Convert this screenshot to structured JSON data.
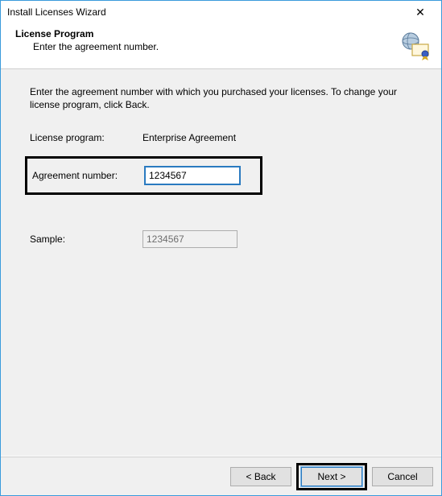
{
  "window": {
    "title": "Install Licenses Wizard",
    "close_glyph": "✕"
  },
  "header": {
    "heading": "License Program",
    "sub": "Enter the agreement number."
  },
  "main": {
    "intro": "Enter the agreement number with which you purchased your licenses. To change your license program, click Back.",
    "license_program_label": "License program:",
    "license_program_value": "Enterprise Agreement",
    "agreement_label": "Agreement number:",
    "agreement_value": "1234567",
    "sample_label": "Sample:",
    "sample_value": "1234567"
  },
  "footer": {
    "back": "< Back",
    "next": "Next >",
    "cancel": "Cancel"
  }
}
